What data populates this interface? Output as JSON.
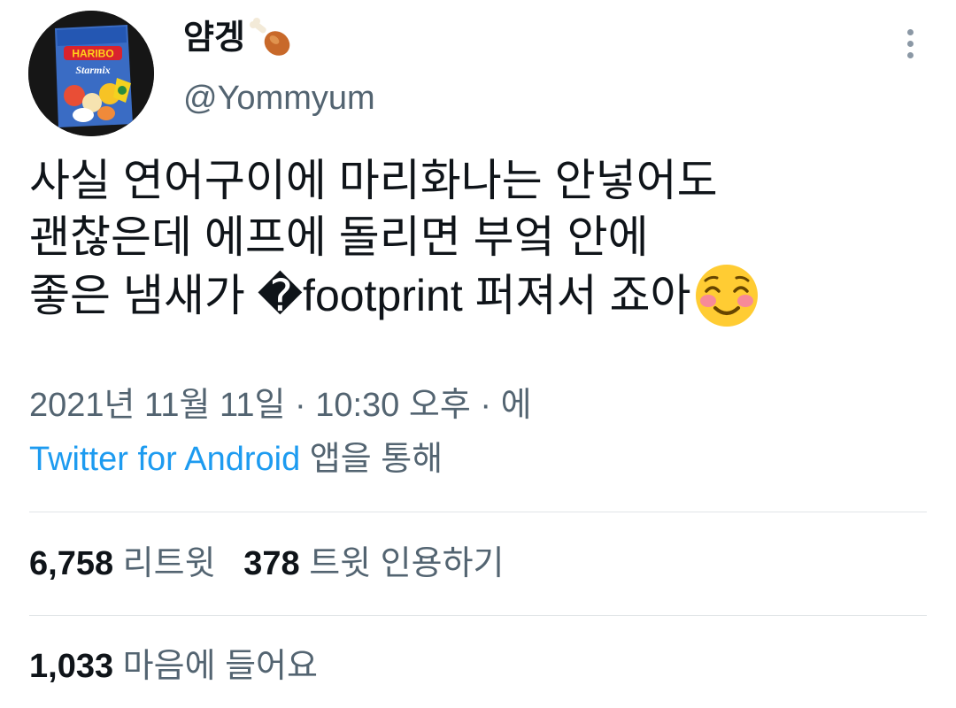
{
  "author": {
    "display_name": "얌겡",
    "handle": "@Yommyum",
    "avatar_icon": "haribo-starmix-bag-avatar",
    "name_emoji_icon": "poultry-leg-emoji",
    "avatar_brand_text": "HARIBO",
    "avatar_product_text": "Starmix"
  },
  "tweet": {
    "lines": [
      "사실 연어구이에 마리화나는 안넣어도",
      "괜찮은데 에프에 돌리면 부엌 안에",
      "좋은 냄새가 �footprint 퍼져서 죠아"
    ],
    "trailing_emoji_icon": "smiling-face-with-blush-emoji"
  },
  "meta": {
    "date": "2021년 11월 11일",
    "separator": " · ",
    "time": "10:30 오후",
    "via_prefix": "에",
    "source_app": "Twitter for Android",
    "source_suffix": " 앱을 통해"
  },
  "stats": {
    "retweets_count": "6,758",
    "retweets_label": "리트윗",
    "quotes_count": "378",
    "quotes_label": "트윗 인용하기",
    "likes_count": "1,033",
    "likes_label": "마음에 들어요"
  },
  "colors": {
    "text_primary": "#0f1419",
    "text_secondary": "#536471",
    "link": "#1d9bf0",
    "divider": "#e1e5e8"
  }
}
